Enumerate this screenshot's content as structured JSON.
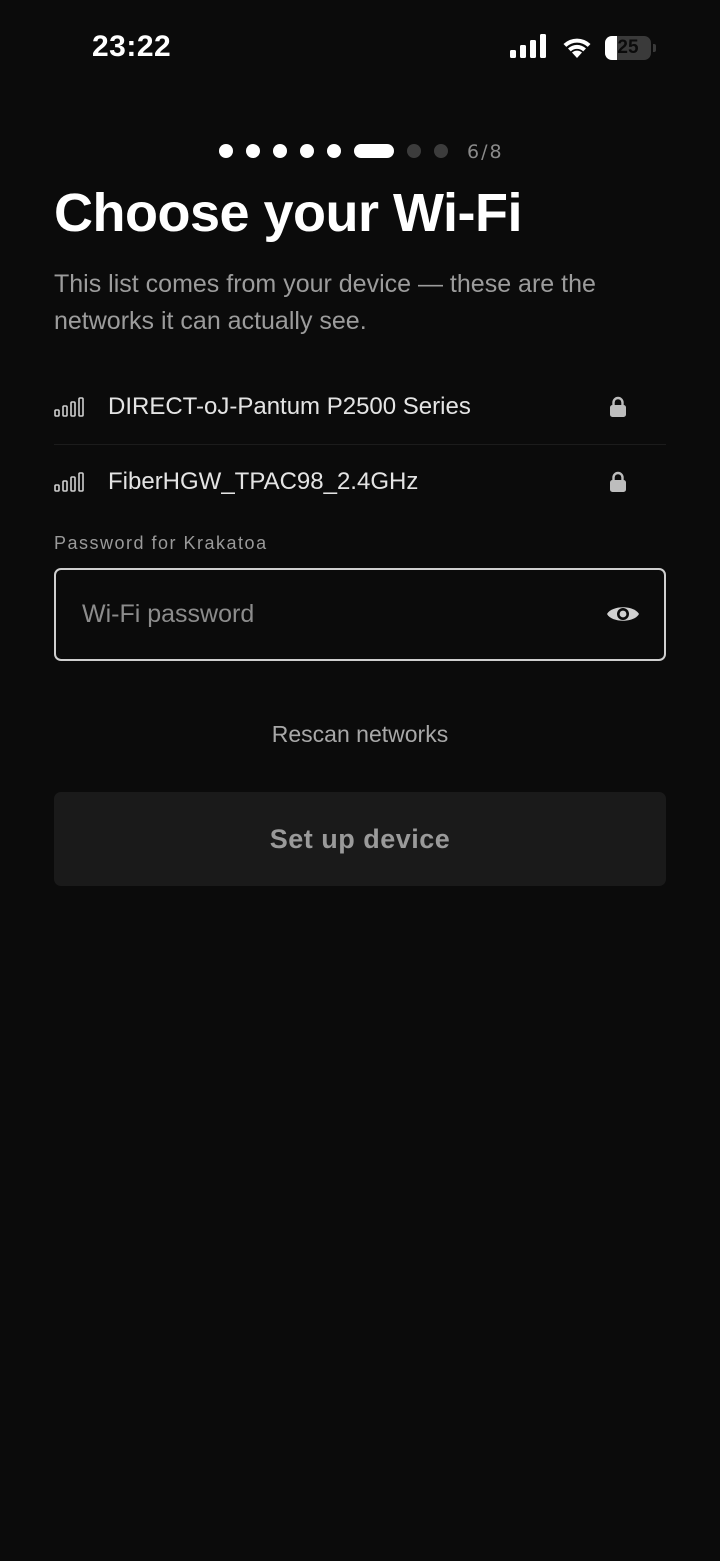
{
  "status_bar": {
    "time": "23:22",
    "battery_level": "25",
    "battery_fraction": 0.25,
    "icons": [
      "cellular-signal-icon",
      "wifi-icon",
      "battery-icon"
    ]
  },
  "progress": {
    "current_step": 6,
    "total_steps": 8,
    "label": "6/8"
  },
  "header": {
    "title": "Choose your Wi-Fi",
    "subtitle": "This list comes from your device — these are the networks it can actually see."
  },
  "networks": [
    {
      "name": "DIRECT-oJ-Pantum P2500 Series",
      "secured": true,
      "icon": "wifi-signal-icon"
    },
    {
      "name": "FiberHGW_TPAC98_2.4GHz",
      "secured": true,
      "icon": "wifi-signal-icon"
    }
  ],
  "password": {
    "label": "Password for Krakatoa",
    "placeholder": "Wi-Fi password",
    "value": "",
    "toggle_icon": "eye-icon"
  },
  "actions": {
    "rescan_label": "Rescan networks",
    "setup_label": "Set up device"
  },
  "colors": {
    "background": "#0b0b0b",
    "text_primary": "#ffffff",
    "text_secondary": "#9c9c9c",
    "button_disabled_bg": "#1a1a1a",
    "dot_inactive": "#3c3c3c"
  }
}
